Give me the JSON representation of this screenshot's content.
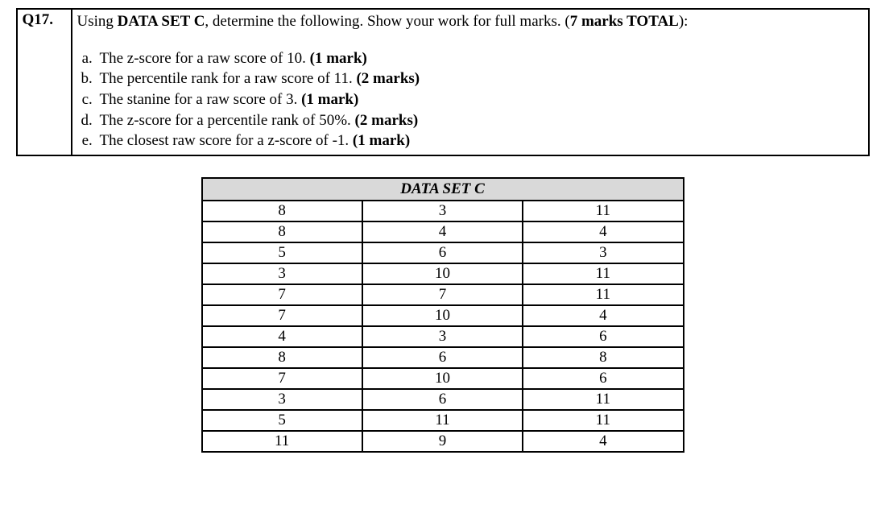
{
  "question": {
    "number": "Q17.",
    "prompt_pre": "Using ",
    "prompt_dataset": "DATA SET C",
    "prompt_mid": ", determine the following. Show your work for full marks. (",
    "prompt_marks": "7 marks TOTAL",
    "prompt_post": "):",
    "parts": [
      {
        "text": "The z-score for a raw score of 10. ",
        "marks": "(1 mark)"
      },
      {
        "text": "The percentile rank for a raw score of 11. ",
        "marks": "(2 marks)"
      },
      {
        "text": "The stanine for a raw score of 3. ",
        "marks": "(1 mark)"
      },
      {
        "text": "The z-score for a percentile rank of 50%. ",
        "marks": "(2 marks)"
      },
      {
        "text": "The closest raw score for a z-score of -1. ",
        "marks": "(1 mark)"
      }
    ]
  },
  "dataset": {
    "title": "DATA SET C",
    "rows": [
      [
        "8",
        "3",
        "11"
      ],
      [
        "8",
        "4",
        "4"
      ],
      [
        "5",
        "6",
        "3"
      ],
      [
        "3",
        "10",
        "11"
      ],
      [
        "7",
        "7",
        "11"
      ],
      [
        "7",
        "10",
        "4"
      ],
      [
        "4",
        "3",
        "6"
      ],
      [
        "8",
        "6",
        "8"
      ],
      [
        "7",
        "10",
        "6"
      ],
      [
        "3",
        "6",
        "11"
      ],
      [
        "5",
        "11",
        "11"
      ],
      [
        "11",
        "9",
        "4"
      ]
    ]
  }
}
